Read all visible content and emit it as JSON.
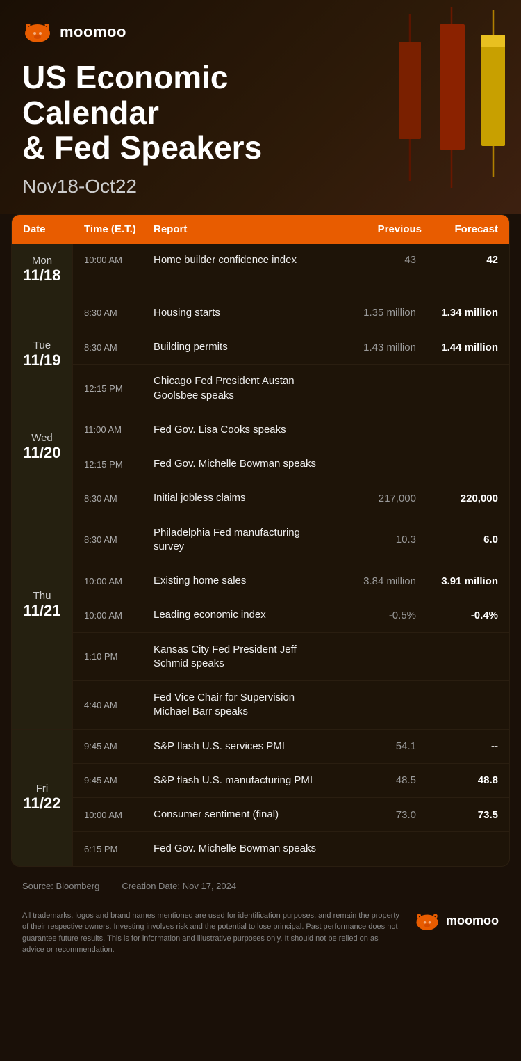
{
  "brand": {
    "name": "moomoo",
    "logo_alt": "moomoo logo"
  },
  "header": {
    "title_line1": "US Economic Calendar",
    "title_line2": "& Fed Speakers",
    "date_range": "Nov18-Oct22"
  },
  "table": {
    "columns": {
      "date": "Date",
      "time": "Time (E.T.)",
      "report": "Report",
      "previous": "Previous",
      "forecast": "Forecast"
    },
    "days": [
      {
        "day_name": "Mon",
        "day_date": "11/18",
        "events": [
          {
            "time": "10:00 AM",
            "report": "Home builder confidence index",
            "previous": "43",
            "forecast": "42"
          }
        ]
      },
      {
        "day_name": "Tue",
        "day_date": "11/19",
        "events": [
          {
            "time": "8:30 AM",
            "report": "Housing starts",
            "previous": "1.35 million",
            "forecast": "1.34 million"
          },
          {
            "time": "8:30 AM",
            "report": "Building permits",
            "previous": "1.43 million",
            "forecast": "1.44 million"
          },
          {
            "time": "12:15 PM",
            "report": "Chicago Fed President Austan Goolsbee speaks",
            "previous": "",
            "forecast": ""
          }
        ]
      },
      {
        "day_name": "Wed",
        "day_date": "11/20",
        "events": [
          {
            "time": "11:00 AM",
            "report": "Fed Gov. Lisa Cooks speaks",
            "previous": "",
            "forecast": ""
          },
          {
            "time": "12:15 PM",
            "report": "Fed Gov. Michelle Bowman speaks",
            "previous": "",
            "forecast": ""
          }
        ]
      },
      {
        "day_name": "Thu",
        "day_date": "11/21",
        "events": [
          {
            "time": "8:30 AM",
            "report": "Initial jobless claims",
            "previous": "217,000",
            "forecast": "220,000"
          },
          {
            "time": "8:30 AM",
            "report": "Philadelphia Fed manufacturing survey",
            "previous": "10.3",
            "forecast": "6.0"
          },
          {
            "time": "10:00 AM",
            "report": "Existing home sales",
            "previous": "3.84 million",
            "forecast": "3.91 million"
          },
          {
            "time": "10:00 AM",
            "report": "Leading economic index",
            "previous": "-0.5%",
            "forecast": "-0.4%"
          },
          {
            "time": "1:10 PM",
            "report": "Kansas City Fed President Jeff Schmid speaks",
            "previous": "",
            "forecast": ""
          },
          {
            "time": "4:40 AM",
            "report": "Fed Vice Chair for Supervision Michael Barr speaks",
            "previous": "",
            "forecast": ""
          }
        ]
      },
      {
        "day_name": "Fri",
        "day_date": "11/22",
        "events": [
          {
            "time": "9:45 AM",
            "report": "S&P flash U.S. services PMI",
            "previous": "54.1",
            "forecast": "--"
          },
          {
            "time": "9:45 AM",
            "report": "S&P flash U.S. manufacturing PMI",
            "previous": "48.5",
            "forecast": "48.8"
          },
          {
            "time": "10:00 AM",
            "report": "Consumer sentiment (final)",
            "previous": "73.0",
            "forecast": "73.5"
          },
          {
            "time": "6:15 PM",
            "report": "Fed Gov. Michelle Bowman speaks",
            "previous": "",
            "forecast": ""
          }
        ]
      }
    ]
  },
  "footer": {
    "source_label": "Source:",
    "source_value": "Bloomberg",
    "creation_label": "Creation Date:",
    "creation_value": "Nov 17, 2024",
    "disclaimer": "All trademarks, logos and brand names mentioned are used for identification purposes, and remain the property of their respective owners. Investing involves risk and the potential to lose principal. Past performance does not guarantee future results. This is for information and illustrative purposes only. It should not be relied on as advice or recommendation."
  }
}
